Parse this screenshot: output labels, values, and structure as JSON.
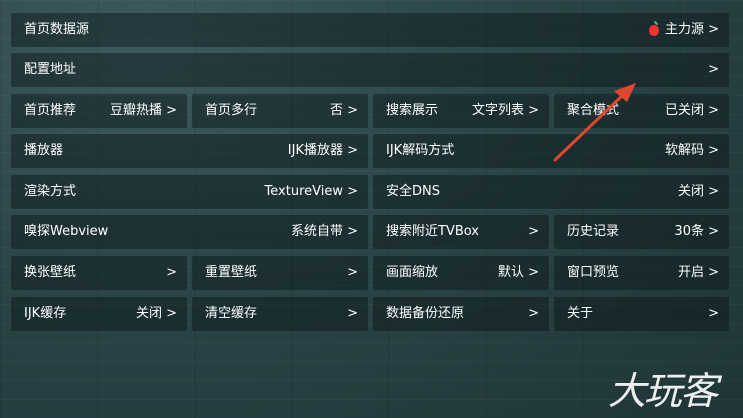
{
  "settings": {
    "home_source": {
      "label": "首页数据源",
      "value": "主力源 >",
      "icon": "apple-icon"
    },
    "config_url": {
      "label": "配置地址",
      "value": ">"
    },
    "row3": [
      {
        "label": "首页推荐",
        "value": "豆瓣热播 >"
      },
      {
        "label": "首页多行",
        "value": "否 >"
      },
      {
        "label": "搜索展示",
        "value": "文字列表 >"
      },
      {
        "label": "聚合模式",
        "value": "已关闭 >"
      }
    ],
    "row4": [
      {
        "label": "播放器",
        "value": "IJK播放器 >"
      },
      {
        "label": "IJK解码方式",
        "value": "软解码 >"
      }
    ],
    "row5": [
      {
        "label": "渲染方式",
        "value": "TextureView >"
      },
      {
        "label": "安全DNS",
        "value": "关闭 >"
      }
    ],
    "row6": [
      {
        "label": "嗅探Webview",
        "value": "系统自带 >"
      },
      {
        "label": "搜索附近TVBox",
        "value": ">"
      },
      {
        "label": "历史记录",
        "value": "30条 >"
      }
    ],
    "row7": [
      {
        "label": "换张壁纸",
        "value": ">"
      },
      {
        "label": "重置壁纸",
        "value": ">"
      },
      {
        "label": "画面缩放",
        "value": "默认 >"
      },
      {
        "label": "窗口预览",
        "value": "开启 >"
      }
    ],
    "row8": [
      {
        "label": "IJK缓存",
        "value": "关闭 >"
      },
      {
        "label": "清空缓存",
        "value": ">"
      },
      {
        "label": "数据备份还原",
        "value": ">"
      },
      {
        "label": "关于",
        "value": ">"
      }
    ]
  },
  "annotation": {
    "color": "#e0472b"
  },
  "watermark": {
    "text": "大玩客"
  }
}
